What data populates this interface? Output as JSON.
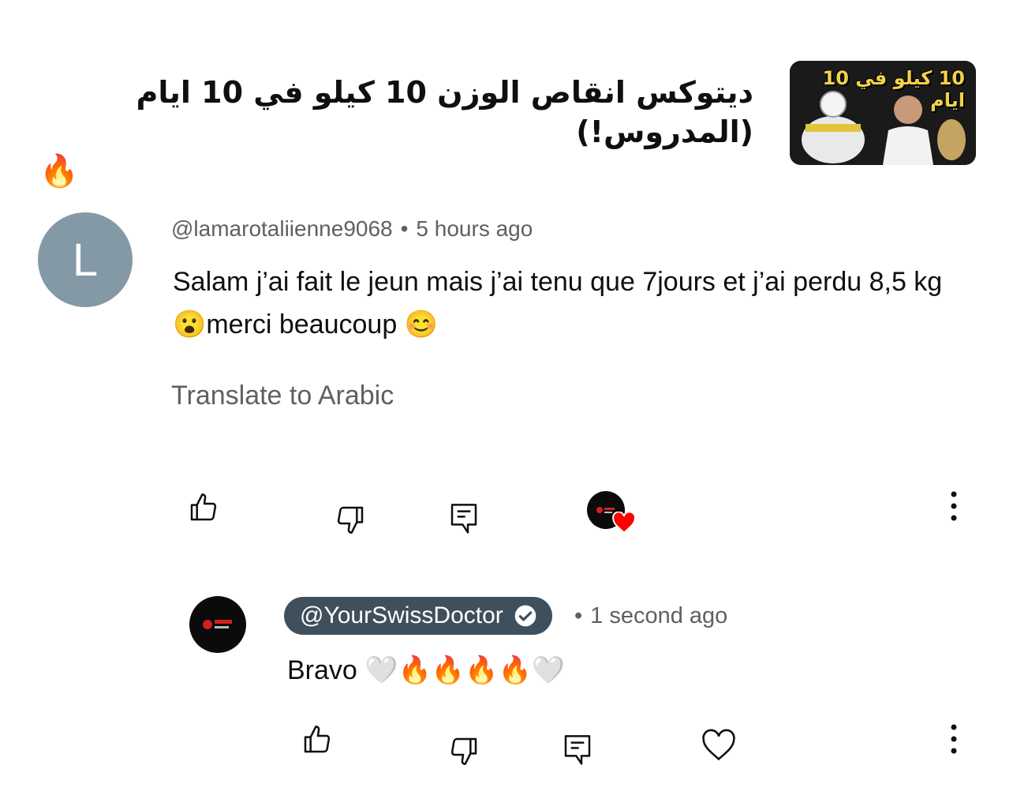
{
  "video": {
    "title": "ديتوكس انقاص الوزن 10 كيلو في 10 ايام (المدروس!)",
    "title_emoji": "🔥",
    "thumbnail_text": "10 كيلو في 10 ايام"
  },
  "comment": {
    "avatar_letter": "L",
    "author": "@lamarotaliienne9068",
    "separator": "•",
    "time": "5 hours ago",
    "text": "Salam j’ai fait le jeun mais j’ai tenu que 7jours et j’ai perdu 8,5 kg 😮merci beaucoup 😊",
    "translate_label": "Translate to Arabic"
  },
  "reply": {
    "author": "@YourSwissDoctor",
    "separator": "•",
    "time": "1 second ago",
    "text": "Bravo 🤍🔥🔥🔥🔥🤍"
  },
  "icons": {
    "like": "thumbs-up-icon",
    "dislike": "thumbs-down-icon",
    "reply": "comment-reply-icon",
    "heart": "heart-icon",
    "more": "more-vertical-icon",
    "verified": "verified-check-icon"
  },
  "colors": {
    "heart_red": "#ff0000",
    "chip_bg": "#3f4f5c",
    "avatar_bg": "#8499a6",
    "secondary_text": "#606060"
  }
}
